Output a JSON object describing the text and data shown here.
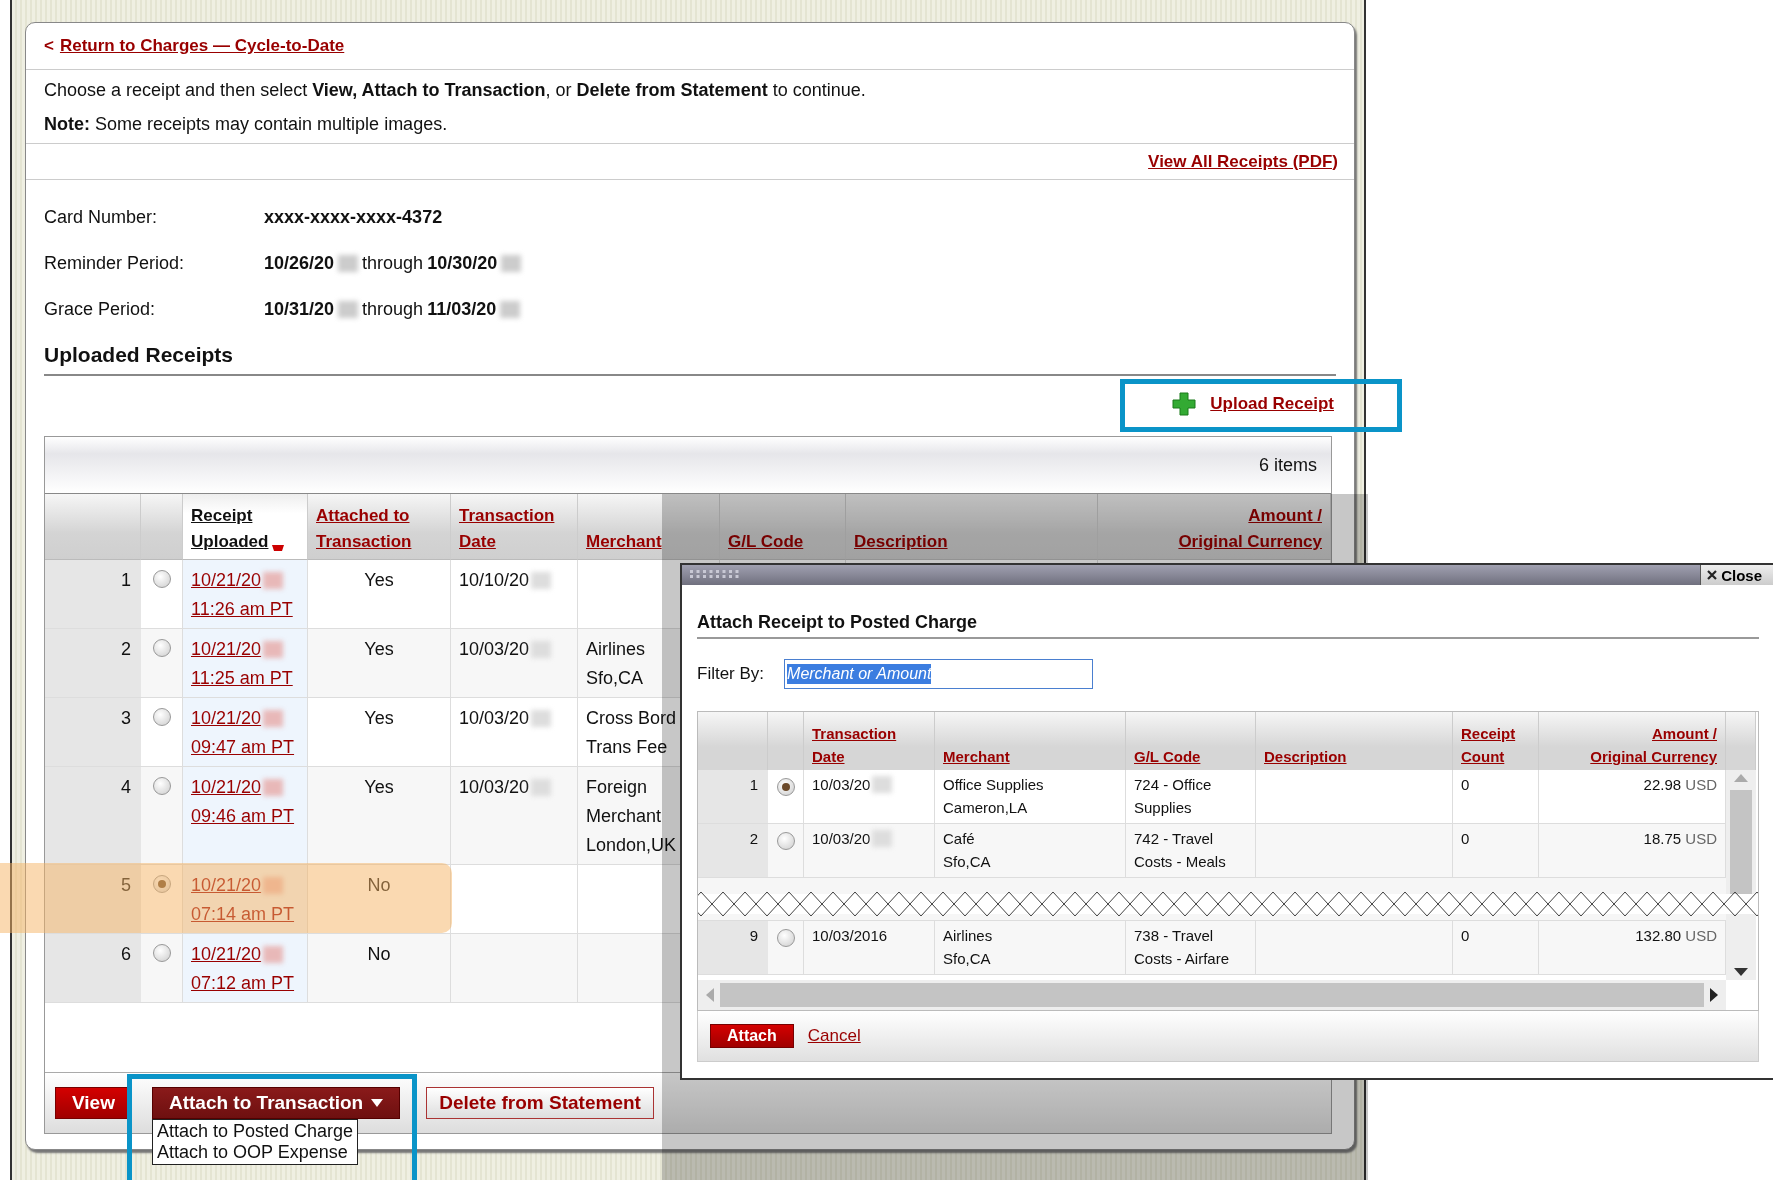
{
  "back_link": {
    "arrow": "<",
    "label": "Return to Charges — Cycle-to-Date"
  },
  "instructions": "Choose a receipt and then select **View, Attach to Transaction**, or **Delete from Statement** to continue.",
  "note": "**Note:** Some receipts may contain multiple images.",
  "view_all_link": "View All Receipts (PDF)",
  "details": [
    {
      "label": "Card Number:",
      "parts": [
        "xxxx-xxxx-xxxx-4372"
      ]
    },
    {
      "label": "Reminder Period:",
      "parts": [
        "10/26/20",
        "10/30/20"
      ],
      "connector": "through"
    },
    {
      "label": "Grace Period:",
      "parts": [
        "10/31/20",
        "11/03/20"
      ],
      "connector": "through"
    }
  ],
  "section_title": "Uploaded Receipts",
  "upload_link": "Upload Receipt",
  "item_count": "6 items",
  "columns": [
    {
      "label": "Receipt\nUploaded",
      "sorted": true
    },
    {
      "label": "Attached to\nTransaction",
      "sorted": false
    },
    {
      "label": "Transaction\nDate",
      "sorted": false
    },
    {
      "label": "Merchant",
      "sorted": false
    },
    {
      "label": "G/L Code",
      "sorted": false
    },
    {
      "label": "Description",
      "sorted": false
    },
    {
      "label": "Amount /\nOriginal Currency",
      "sorted": false
    }
  ],
  "rows": [
    {
      "num": "1",
      "selected": false,
      "uploaded_date": "10/21/20",
      "uploaded_time": "11:26 am PT",
      "attached": "Yes",
      "txn_date": "10/10/20",
      "merchant": []
    },
    {
      "num": "2",
      "selected": false,
      "uploaded_date": "10/21/20",
      "uploaded_time": "11:25 am PT",
      "attached": "Yes",
      "txn_date": "10/03/20",
      "merchant": [
        "Airlines",
        "Sfo,CA"
      ]
    },
    {
      "num": "3",
      "selected": false,
      "uploaded_date": "10/21/20",
      "uploaded_time": "09:47 am PT",
      "attached": "Yes",
      "txn_date": "10/03/20",
      "merchant": [
        "Cross Bord",
        "Trans Fee"
      ]
    },
    {
      "num": "4",
      "selected": false,
      "uploaded_date": "10/21/20",
      "uploaded_time": "09:46 am PT",
      "attached": "Yes",
      "txn_date": "10/03/20",
      "merchant": [
        "Foreign",
        "Merchant",
        "London,UK"
      ]
    },
    {
      "num": "5",
      "selected": true,
      "uploaded_date": "10/21/20",
      "uploaded_time": "07:14 am PT",
      "attached": "No",
      "txn_date": "",
      "merchant": []
    },
    {
      "num": "6",
      "selected": false,
      "uploaded_date": "10/21/20",
      "uploaded_time": "07:12 am PT",
      "attached": "No",
      "txn_date": "",
      "merchant": []
    }
  ],
  "buttons": {
    "view": "View",
    "attach": "Attach to Transaction",
    "delete": "Delete from Statement"
  },
  "attach_menu": [
    "Attach to Posted Charge",
    "Attach to OOP Expense"
  ],
  "modal": {
    "close": "Close",
    "title": "Attach Receipt to Posted Charge",
    "filter_label": "Filter By:",
    "filter_value": "Merchant or Amount",
    "columns": [
      "Transaction\nDate",
      "Merchant",
      "G/L Code",
      "Description",
      "Receipt\nCount",
      "Amount /\nOriginal Currency"
    ],
    "rows": [
      {
        "kind": "row",
        "num": "1",
        "selected": true,
        "date": "10/03/20",
        "redacted": true,
        "merchant": [
          "Office Supplies",
          "Cameron,LA"
        ],
        "gl": [
          "724 - Office",
          "Supplies"
        ],
        "count": "0",
        "amount": "22.98",
        "currency": "USD"
      },
      {
        "kind": "row",
        "num": "2",
        "selected": false,
        "date": "10/03/20",
        "redacted": true,
        "merchant": [
          "Café",
          "Sfo,CA"
        ],
        "gl": [
          "742 - Travel",
          "Costs - Meals"
        ],
        "count": "0",
        "amount": "18.75",
        "currency": "USD"
      },
      {
        "kind": "torn"
      },
      {
        "kind": "row",
        "num": "9",
        "selected": false,
        "date": "10/03/2016",
        "redacted": false,
        "merchant": [
          "Airlines",
          "Sfo,CA"
        ],
        "gl": [
          "738 - Travel",
          "Costs - Airfare"
        ],
        "count": "0",
        "amount": "132.80",
        "currency": "USD"
      }
    ],
    "attach": "Attach",
    "cancel": "Cancel"
  }
}
